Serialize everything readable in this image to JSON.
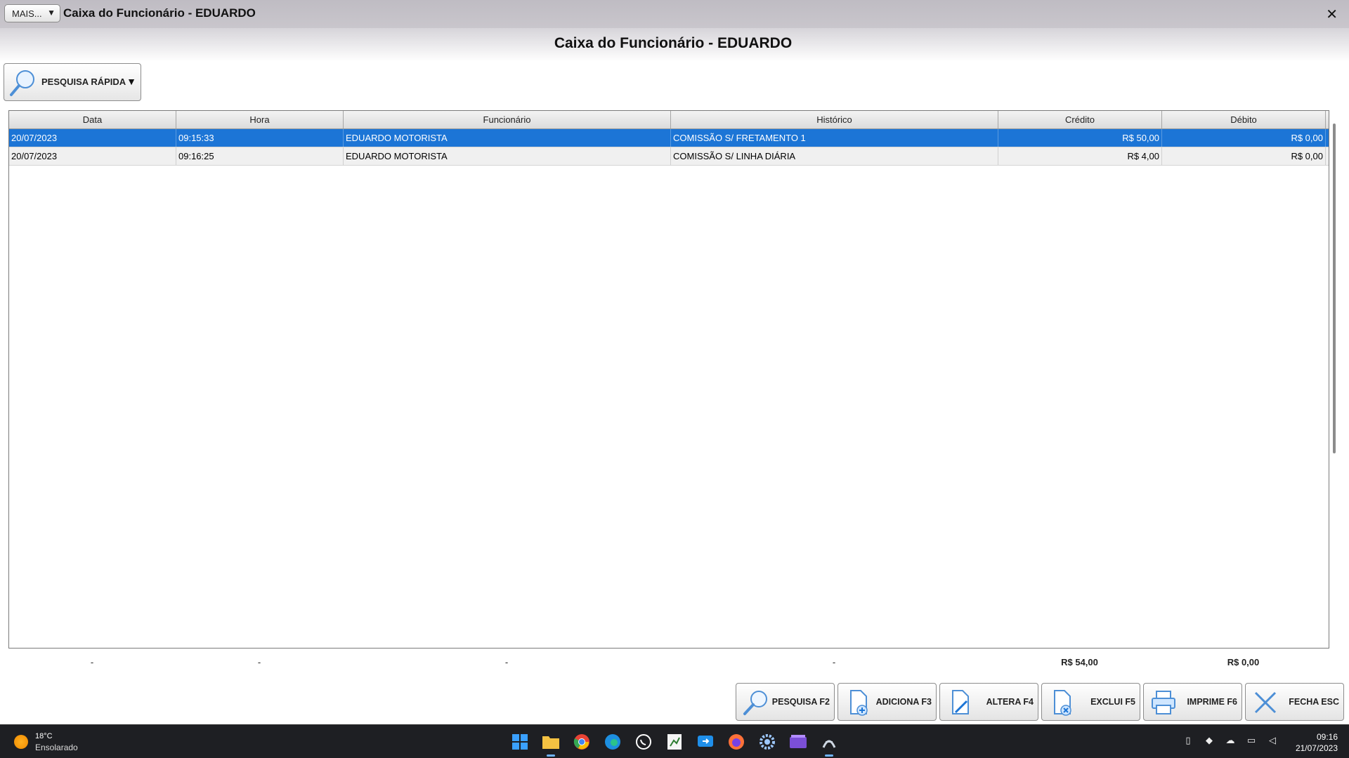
{
  "titlebar": {
    "mais_label": "MAIS...",
    "window_title": "Caixa do Funcionário - EDUARDO",
    "close_symbol": "✕"
  },
  "main_title": "Caixa do Funcionário - EDUARDO",
  "quick_search": {
    "label": "PESQUISA RÁPIDA",
    "icon": "search-icon"
  },
  "table": {
    "columns": [
      "Data",
      "Hora",
      "Funcionário",
      "Histórico",
      "Crédito",
      "Débito"
    ],
    "rows": [
      {
        "data": "20/07/2023",
        "hora": "09:15:33",
        "funcionario": "EDUARDO MOTORISTA",
        "historico": "COMISSÃO S/ FRETAMENTO 1",
        "credito": "R$ 50,00",
        "debito": "R$ 0,00",
        "selected": true
      },
      {
        "data": "20/07/2023",
        "hora": "09:16:25",
        "funcionario": "EDUARDO MOTORISTA",
        "historico": "COMISSÃO S/ LINHA DIÁRIA",
        "credito": "R$ 4,00",
        "debito": "R$ 0,00",
        "selected": false
      }
    ]
  },
  "totals": {
    "data": "-",
    "hora": "-",
    "funcionario": "-",
    "historico": "-",
    "credito": "R$ 54,00",
    "debito": "R$ 0,00"
  },
  "actions": [
    {
      "label": "PESQUISA F2",
      "icon": "search-icon"
    },
    {
      "label": "ADICIONA F3",
      "icon": "add-document-icon"
    },
    {
      "label": "ALTERA F4",
      "icon": "edit-document-icon"
    },
    {
      "label": "EXCLUI F5",
      "icon": "delete-document-icon"
    },
    {
      "label": "IMPRIME F6",
      "icon": "printer-icon"
    },
    {
      "label": "FECHA ESC",
      "icon": "close-icon"
    }
  ],
  "taskbar": {
    "weather_temp": "18°C",
    "weather_desc": "Ensolarado",
    "apps": [
      "windows-start-icon",
      "file-explorer-icon",
      "chrome-icon",
      "edge-icon",
      "whatsapp-icon",
      "spreadsheet-icon",
      "remote-icon",
      "firefox-icon",
      "settings-icon",
      "media-icon",
      "app-icon"
    ],
    "clock_time": "09:16",
    "clock_date": "21/07/2023"
  },
  "colors": {
    "selection": "#1c75d6",
    "taskbar": "#1e1f23",
    "titlebar": "#c4c1c8"
  }
}
